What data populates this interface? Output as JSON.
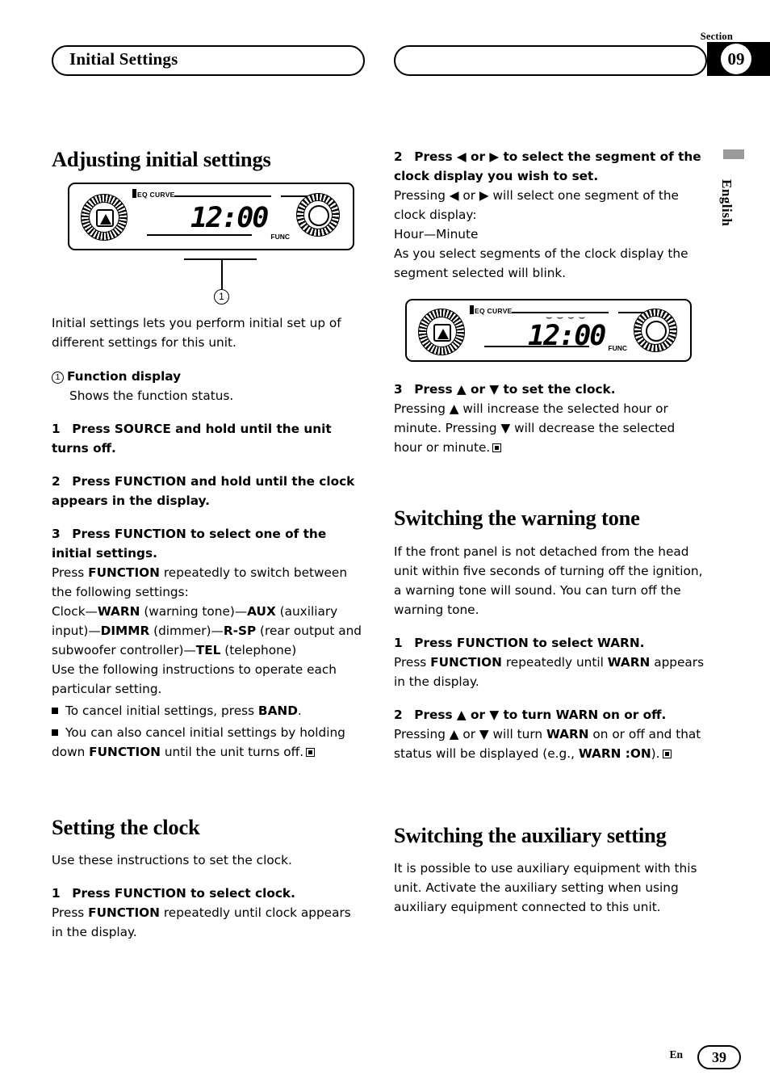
{
  "header": {
    "section_label": "Section",
    "section_number": "09",
    "title": "Initial Settings",
    "language_tab": "English"
  },
  "left": {
    "h1_adjusting": "Adjusting initial settings",
    "display_value": "12:00",
    "callout_1": "1",
    "intro": "Initial settings lets you perform initial set up of different settings for this unit.",
    "func_display_label": "Function display",
    "func_display_desc": "Shows the function status.",
    "step1_head_num": "1",
    "step1_head": "Press SOURCE and hold until the unit turns off.",
    "step2_head_num": "2",
    "step2_head": "Press FUNCTION and hold until the clock appears in the display.",
    "step3_head_num": "3",
    "step3_head": "Press FUNCTION to select one of the initial settings.",
    "step3_body_1": "Press ",
    "step3_body_b1": "FUNCTION",
    "step3_body_2": " repeatedly to switch between the following settings:",
    "settings_chain": [
      {
        "t": "Clock—",
        "b": false
      },
      {
        "t": "WARN",
        "b": true
      },
      {
        "t": " (warning tone)—",
        "b": false
      },
      {
        "t": "AUX",
        "b": true
      },
      {
        "t": " (auxiliary input)—",
        "b": false
      },
      {
        "t": "DIMMR",
        "b": true
      },
      {
        "t": " (dimmer)—",
        "b": false
      },
      {
        "t": "R-SP",
        "b": true
      },
      {
        "t": " (rear output and subwoofer controller)—",
        "b": false
      },
      {
        "t": "TEL",
        "b": true
      },
      {
        "t": " (telephone)",
        "b": false
      }
    ],
    "step3_body_3": "Use the following instructions to operate each particular setting.",
    "bullet_1_a": "To cancel initial settings, press ",
    "bullet_1_b": "BAND",
    "bullet_1_c": ".",
    "bullet_2_a": "You can also cancel initial settings by holding down ",
    "bullet_2_b": "FUNCTION",
    "bullet_2_c": " until the unit turns off.",
    "h1_clock": "Setting the clock",
    "clock_intro": "Use these instructions to set the clock.",
    "clock_step1_num": "1",
    "clock_step1_head": "Press FUNCTION to select clock.",
    "clock_step1_body_a": "Press ",
    "clock_step1_body_b": "FUNCTION",
    "clock_step1_body_c": " repeatedly until clock appears in the display."
  },
  "right": {
    "step2_num": "2",
    "step2_head": "Press ◀ or ▶ to select the segment of the clock display you wish to set.",
    "step2_body_1": "Pressing ◀ or ▶ will select one segment of the clock display:",
    "step2_body_2": "Hour—Minute",
    "step2_body_3": "As you select segments of the clock display the segment selected will blink.",
    "display_value": "12:00",
    "step3_num": "3",
    "step3_head": "Press ▲ or ▼ to set the clock.",
    "step3_body": "Pressing ▲ will increase the selected hour or minute. Pressing ▼ will decrease the selected hour or minute.",
    "h1_warning": "Switching the warning tone",
    "warning_intro": "If the front panel is not detached from the head unit within five seconds of turning off the ignition, a warning tone will sound. You can turn off the warning tone.",
    "w_step1_num": "1",
    "w_step1_head": "Press FUNCTION to select WARN.",
    "w_step1_body_a": "Press ",
    "w_step1_body_b": "FUNCTION",
    "w_step1_body_c": " repeatedly until ",
    "w_step1_body_d": "WARN",
    "w_step1_body_e": " appears in the display.",
    "w_step2_num": "2",
    "w_step2_head": "Press ▲ or ▼ to turn WARN on or off.",
    "w_step2_body_a": "Pressing ▲ or ▼ will turn ",
    "w_step2_body_b": "WARN",
    "w_step2_body_c": " on or off and that status will be displayed (e.g., ",
    "w_step2_body_d": "WARN :ON",
    "w_step2_body_e": ").",
    "h1_aux": "Switching the auxiliary setting",
    "aux_body": "It is possible to use auxiliary equipment with this unit. Activate the auxiliary setting when using auxiliary equipment connected to this unit."
  },
  "unit_labels": {
    "eq_curve": "EQ CURVE",
    "func": "FUNC"
  },
  "footer": {
    "lang": "En",
    "page": "39"
  }
}
